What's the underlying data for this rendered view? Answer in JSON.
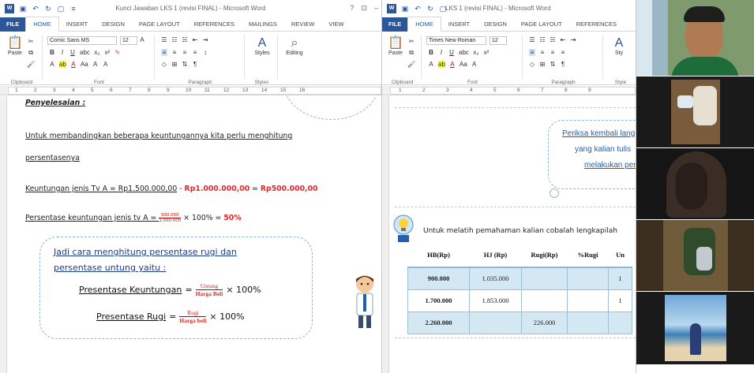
{
  "window_left": {
    "title": "Kunci Jawaban LKS 1 (revisi FINAL) - Microsoft Word",
    "tabs": [
      "FILE",
      "HOME",
      "INSERT",
      "DESIGN",
      "PAGE LAYOUT",
      "REFERENCES",
      "MAILINGS",
      "REVIEW",
      "VIEW"
    ],
    "font_name": "Comic Sans MS",
    "font_size": "12",
    "group_labels": {
      "clipboard": "Clipboard",
      "font": "Font",
      "paragraph": "Paragraph",
      "styles": "Styles",
      "editing": "Editing"
    },
    "styles_label": "Styles",
    "editing_label": "Editing",
    "paste_label": "Paste",
    "ruler_marks": [
      "1",
      "2",
      "3",
      "4",
      "5",
      "6",
      "7",
      "8",
      "9",
      "10",
      "11",
      "12",
      "13",
      "14",
      "15",
      "16"
    ],
    "doc": {
      "heading": "Penyelesaian :",
      "line1": "Untuk   membandingkan   beberapa   keuntungannya   kita   perlu   menghitung",
      "line2": "persentasenya",
      "line3_label": "Keuntungan jenis Tv A = ",
      "line3_val1": "Rp1.500.000,00",
      "line3_minus": " - ",
      "line3_val2": "Rp1.000.000,00",
      "line3_eq": " = ",
      "line3_val3": "Rp500.000,00",
      "line4_label": "Persentase keuntungan jenis tv A = ",
      "line4_num": "500.000",
      "line4_den": "1.000.000",
      "line4_times": " × 100% = ",
      "line4_result": "50%",
      "bubble_line1": "Jadi   cara   menghitung   persentase   rugi   dan",
      "bubble_line2": "persentase untung yaitu :",
      "formula1_label": "Presentase Keuntungan",
      "formula1_num": "Untung",
      "formula1_den": "Harga Beli",
      "formula1_tail": "× 100%",
      "formula2_label": "Presentase Rugi",
      "formula2_num": "Rugi",
      "formula2_den": "Harga beli",
      "formula2_tail": "× 100%",
      "equals": "="
    }
  },
  "window_right": {
    "title": "LKS 1 (revisi FINAL) - Microsoft Word",
    "tabs": [
      "FILE",
      "HOME",
      "INSERT",
      "DESIGN",
      "PAGE LAYOUT",
      "REFERENCES"
    ],
    "font_name": "Times New Roman",
    "font_size": "12",
    "group_labels": {
      "clipboard": "Clipboard",
      "font": "Font",
      "paragraph": "Paragraph",
      "styles": "Style"
    },
    "paste_label": "Paste",
    "styles_label": "Sty",
    "ruler_marks": [
      "1",
      "2",
      "3",
      "4",
      "5",
      "6",
      "7",
      "8",
      "9"
    ],
    "bubble_line1": "Periksa kembali lang",
    "bubble_line2": "yang kalian tulis",
    "bubble_line3": "melakukan perh",
    "instruction": "Untuk melatih pemahaman kalian cobalah lengkapilah",
    "table": {
      "headers": [
        "HB(Rp)",
        "HJ (Rp)",
        "Rugi(Rp)",
        "%Rugi",
        "Un"
      ],
      "rows": [
        [
          "900.000",
          "1.035.000",
          "",
          "",
          "1"
        ],
        [
          "1.700.000",
          "1.853.000",
          "",
          "",
          "1"
        ],
        [
          "2.260.000",
          "",
          "226.000",
          "",
          ""
        ]
      ]
    }
  },
  "colors": {
    "word_blue": "#2b579a",
    "accent_red": "#e8262a",
    "bubble_border": "#8fb3d6",
    "table_shade": "#d4e8f4"
  }
}
